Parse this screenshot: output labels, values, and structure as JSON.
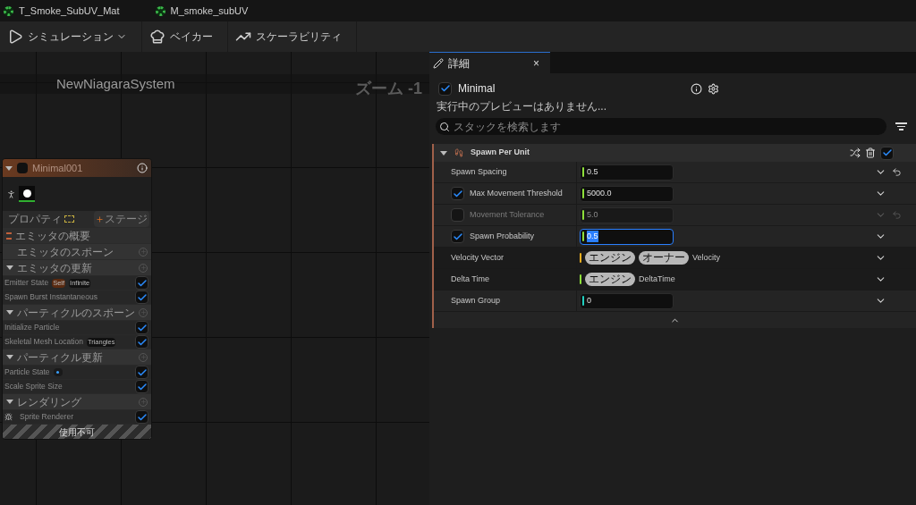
{
  "asset_tabs": [
    {
      "label": "T_Smoke_SubUV_Mat"
    },
    {
      "label": "M_smoke_subUV"
    }
  ],
  "toolbar": [
    {
      "kind": "simulation",
      "label": "シミュレーション"
    },
    {
      "kind": "baker",
      "label": "ベイカー"
    },
    {
      "kind": "scalability",
      "label": "スケーラビリティ"
    }
  ],
  "graph": {
    "title": "NewNiagaraSystem",
    "zoom": "ズーム -1",
    "node": {
      "title": "Minimal001",
      "enabled": false,
      "properties_label": "プロパティ",
      "stage_button": "ステージ",
      "footer": "使用不可",
      "rows": [
        {
          "kind": "summary",
          "label": "エミッタの概要"
        },
        {
          "kind": "section",
          "label": "エミッタのスポーン",
          "expanded": false
        },
        {
          "kind": "section",
          "label": "エミッタの更新",
          "expanded": true
        },
        {
          "kind": "module",
          "label": "Emitter State",
          "tags": [
            {
              "text": "Self",
              "color": "#5a2a10"
            },
            {
              "text": "Infinite",
              "color": "#111111"
            }
          ],
          "checked": true
        },
        {
          "kind": "module",
          "label": "Spawn Burst Instantaneous",
          "checked": true
        },
        {
          "kind": "section",
          "label": "パーティクルのスポーン",
          "expanded": true
        },
        {
          "kind": "module",
          "label": "Initialize Particle",
          "checked": true
        },
        {
          "kind": "module",
          "label": "Skeletal Mesh Location",
          "tags": [
            {
              "text": "Triangles",
              "color": "#111111"
            }
          ],
          "checked": true
        },
        {
          "kind": "section",
          "label": "パーティクル更新",
          "expanded": true
        },
        {
          "kind": "module",
          "label": "Particle State",
          "dot": true,
          "checked": true
        },
        {
          "kind": "module",
          "label": "Scale Sprite Size",
          "checked": true
        },
        {
          "kind": "section",
          "label": "レンダリング",
          "expanded": true
        },
        {
          "kind": "renderer",
          "label": "Sprite Renderer",
          "checked": true
        }
      ]
    }
  },
  "details": {
    "tab": {
      "label": "詳細",
      "close": "×"
    },
    "emitter": {
      "name": "Minimal",
      "checked": true
    },
    "status": "実行中のプレビューはありません...",
    "search": {
      "placeholder": "スタックを検索します"
    },
    "module": {
      "title": "Spawn Per Unit",
      "expanded": true,
      "checked": true,
      "rows": [
        {
          "kind": "value",
          "label": "Spawn Spacing",
          "value": "0.5",
          "color": "#8ee03a",
          "reset": true
        },
        {
          "kind": "value",
          "label": "Max Movement Threshold",
          "value": "5000.0",
          "color": "#8ee03a",
          "checked": true
        },
        {
          "kind": "value",
          "label": "Movement Tolerance",
          "value": "5.0",
          "color": "#8ee03a",
          "checked": false,
          "disabled": true,
          "reset": true
        },
        {
          "kind": "value",
          "label": "Spawn Probability",
          "value": "0.5",
          "color": "#8ee03a",
          "checked": true,
          "selected": true
        },
        {
          "kind": "link",
          "label": "Velocity Vector",
          "tags": [
            "エンジン",
            "オーナー"
          ],
          "value": "Velocity",
          "color": "#f0b020"
        },
        {
          "kind": "link",
          "label": "Delta Time",
          "tags": [
            "エンジン"
          ],
          "value": "DeltaTime",
          "color": "#8ee03a"
        },
        {
          "kind": "value",
          "label": "Spawn Group",
          "value": "0",
          "color": "#20d0c0"
        }
      ]
    }
  }
}
